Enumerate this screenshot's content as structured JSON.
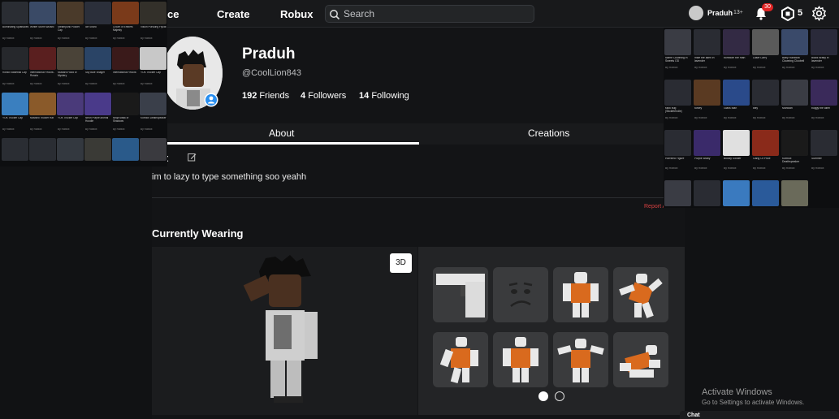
{
  "topbar": {
    "nav_partial": "ce",
    "create": "Create",
    "robux": "Robux",
    "search_placeholder": "Search",
    "username": "Praduh",
    "age_tag": "13+",
    "notif_count": "30",
    "robux_count": "5"
  },
  "profile": {
    "display_name": "Praduh",
    "username": "@CoolLion843",
    "friends_count": "192",
    "friends_label": "Friends",
    "followers_count": "4",
    "followers_label": "Followers",
    "following_count": "14",
    "following_label": "Following"
  },
  "tabs": [
    "About",
    "Creations"
  ],
  "about": {
    "heading": "out",
    "text": "im to lazy to type something soo yeahh",
    "report": "Report Abuse"
  },
  "wearing": {
    "heading": "Currently Wearing",
    "btn3d": "3D"
  },
  "left_panel": [
    {
      "name": "Burninating Splatsicles",
      "by": "By Roblox"
    },
    {
      "name": "Winter Storm Wizard",
      "by": "By Roblox"
    },
    {
      "name": "Steampunk Pocket Cap",
      "by": "By Roblox"
    },
    {
      "name": "Ice Shard",
      "by": "By Roblox"
    },
    {
      "name": "Crown of Embers Majesty",
      "by": "By Roblox"
    },
    {
      "name": "Vision Pursuing Flycat",
      "by": "By Roblox"
    },
    {
      "name": "Roblox Baseball Cap",
      "by": "By Roblox"
    },
    {
      "name": "International Fedora - Russia",
      "by": "By Roblox"
    },
    {
      "name": "Mustard Hood of Mystery",
      "by": "By Roblox"
    },
    {
      "name": "Sky Blue Villager",
      "by": "By Roblox"
    },
    {
      "name": "International Fedora",
      "by": "By Roblox"
    },
    {
      "name": "YOK Trucker Cap",
      "by": "By Roblox"
    },
    {
      "name": "YOK Trucker Cap",
      "by": "By Roblox"
    },
    {
      "name": "Mustard Trucker Hat",
      "by": "By Roblox"
    },
    {
      "name": "YOK Trucker Cap",
      "by": "By Roblox"
    },
    {
      "name": "Neon Purple Animal Hoodie",
      "by": "By Roblox"
    },
    {
      "name": "Ninja Mask of Shadows",
      "by": "By Roblox"
    },
    {
      "name": "Korblox Deathspeaker",
      "by": "By Roblox"
    },
    {
      "name": "",
      "by": ""
    },
    {
      "name": "",
      "by": ""
    },
    {
      "name": "",
      "by": ""
    },
    {
      "name": "",
      "by": ""
    },
    {
      "name": "",
      "by": ""
    },
    {
      "name": "",
      "by": ""
    }
  ],
  "right_panel": [
    {
      "name": "Name Clowning in Sweets OD",
      "by": "By Roblox"
    },
    {
      "name": "mike the alien in lavender",
      "by": "By Roblox"
    },
    {
      "name": "bombom the man",
      "by": "By Roblox"
    },
    {
      "name": "Laser Larry",
      "by": "By Roblox"
    },
    {
      "name": "Baby Rainbow Clowning Cloobell",
      "by": "By Roblox"
    },
    {
      "name": "Black Bratly in lavender",
      "by": "By Roblox"
    },
    {
      "name": "stick bug (Stickfriendle)",
      "by": "By Roblox"
    },
    {
      "name": "turkey",
      "by": "By Roblox"
    },
    {
      "name": "Glass Man",
      "by": "By Roblox"
    },
    {
      "name": "kitty",
      "by": "By Roblox"
    },
    {
      "name": "Manclan",
      "by": "By Roblox"
    },
    {
      "name": "buggy the alien",
      "by": "By Roblox"
    },
    {
      "name": "Horrified Figure",
      "by": "By Roblox"
    },
    {
      "name": "Purple Bratly",
      "by": "By Roblox"
    },
    {
      "name": "Blocky Soldier",
      "by": "By Roblox"
    },
    {
      "name": "Gang Of Price",
      "by": "By Roblox"
    },
    {
      "name": "Korblox Deathspeaker",
      "by": "By Roblox"
    },
    {
      "name": "Summer",
      "by": "By Roblox"
    },
    {
      "name": "",
      "by": ""
    },
    {
      "name": "",
      "by": ""
    },
    {
      "name": "",
      "by": ""
    },
    {
      "name": "",
      "by": ""
    },
    {
      "name": "",
      "by": ""
    }
  ],
  "watermark": {
    "line1": "Activate Windows",
    "line2": "Go to Settings to activate Windows."
  },
  "chat": {
    "label": "Chat"
  },
  "colors": {
    "accent_red": "#d64141",
    "badge_red": "#e02424",
    "orange": "#d96a1e"
  }
}
